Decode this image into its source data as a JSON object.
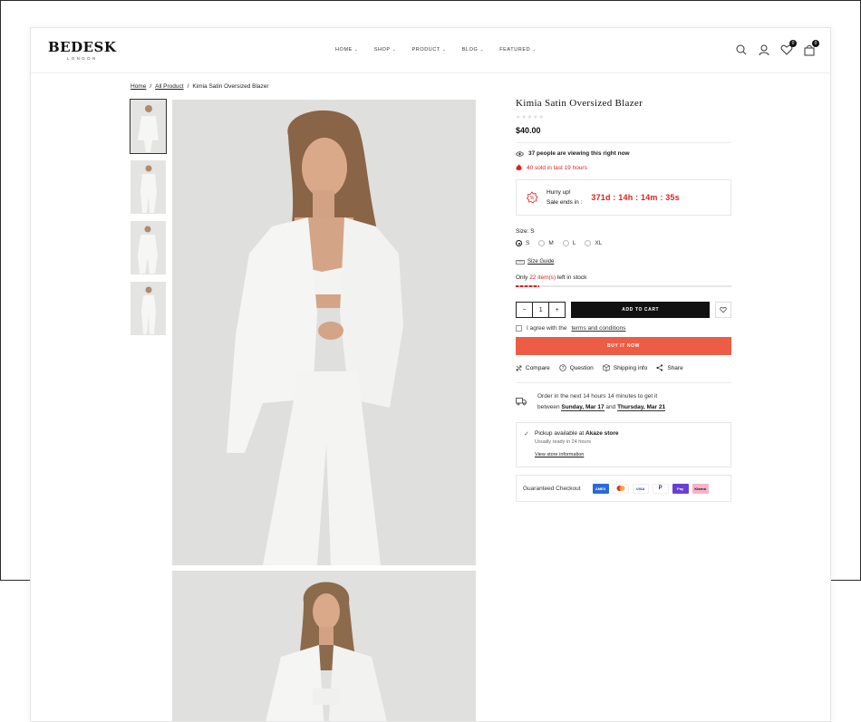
{
  "brand": {
    "name": "BEDESK",
    "sub": "LONDON"
  },
  "nav": [
    {
      "label": "HOME"
    },
    {
      "label": "SHOP"
    },
    {
      "label": "PRODUCT"
    },
    {
      "label": "BLOG"
    },
    {
      "label": "FEATURED"
    }
  ],
  "header": {
    "wishlist_count": "0",
    "cart_count": "0"
  },
  "breadcrumb": {
    "home": "Home",
    "sep": "/",
    "all": "All Product",
    "current": "Kimia Satin Oversized Blazer"
  },
  "product": {
    "title": "Kimia Satin Oversized Blazer",
    "stars": "★★★★★",
    "price": "$40.00",
    "viewing": "37 people are viewing this right now",
    "sold": "40 sold in last 19 hours",
    "hurry": "Hurry up!",
    "sale_ends": "Sale ends in :",
    "countdown": "371d : 14h : 14m : 35s",
    "size_label": "Size: S",
    "sizes": [
      "S",
      "M",
      "L",
      "XL"
    ],
    "selected_size": "S",
    "size_guide": "Size Guide",
    "stock_prefix": "Only",
    "stock_count": "22 item(s)",
    "stock_suffix": "left in stock",
    "stock_level_percent": 11,
    "quantity": "1",
    "add_to_cart": "ADD TO CART",
    "terms_prefix": "I agree with the",
    "terms_link": "terms and conditions",
    "buy_now": "BUY IT NOW",
    "actions": [
      "Compare",
      "Question",
      "Shipping info",
      "Share"
    ],
    "delivery": {
      "line1": "Order in the next 14 hours 14 minutes to get it",
      "between": "between",
      "date1": "Sunday, Mar 17",
      "and": "and",
      "date2": "Thursday, Mar 21"
    },
    "pickup": {
      "prefix": "Pickup available at",
      "store": "Akaze store",
      "ready": "Usually ready in 24 hours",
      "link": "View store information"
    },
    "guaranteed": "Guaranteed Checkout",
    "payments": [
      "AMEX",
      "MC",
      "VISA",
      "P",
      "Pay",
      "Klarna"
    ]
  },
  "colors": {
    "accent": "#ed5c44",
    "sale_red": "#e02020",
    "dark": "#111111"
  }
}
